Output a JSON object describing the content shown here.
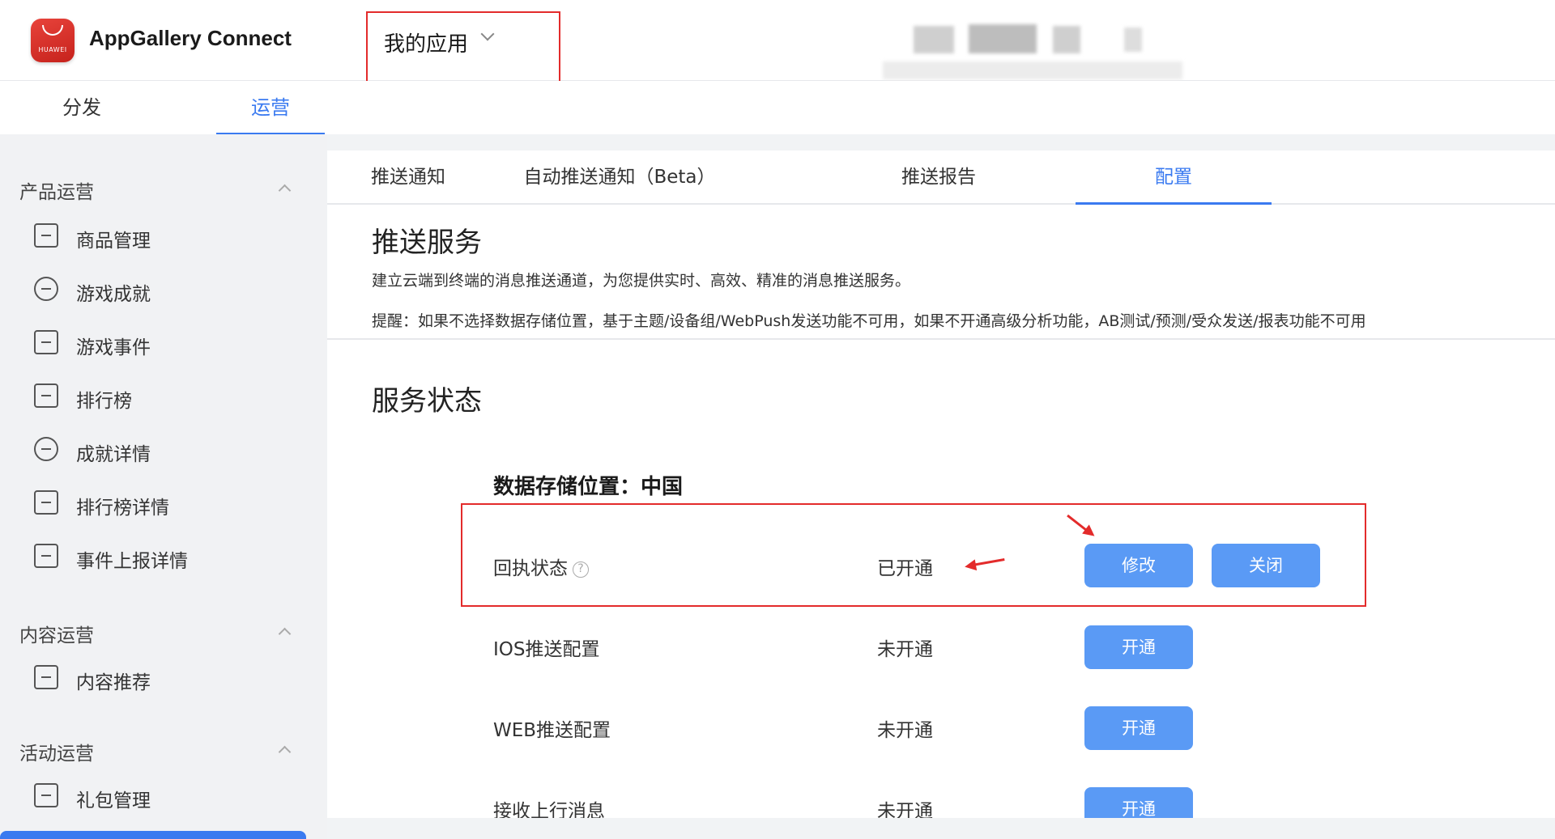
{
  "header": {
    "logo_text": "HUAWEI",
    "brand": "AppGallery Connect",
    "app_selector": "我的应用"
  },
  "topnav": {
    "tabs": [
      {
        "label": "分发",
        "active": false
      },
      {
        "label": "运营",
        "active": true
      }
    ]
  },
  "sidebar": {
    "groups": [
      {
        "title": "产品运营",
        "items": [
          {
            "label": "商品管理",
            "icon": "bag-icon"
          },
          {
            "label": "游戏成就",
            "icon": "achievement-badge-icon"
          },
          {
            "label": "游戏事件",
            "icon": "event-icon"
          },
          {
            "label": "排行榜",
            "icon": "leaderboard-icon"
          },
          {
            "label": "成就详情",
            "icon": "achievement-detail-icon"
          },
          {
            "label": "排行榜详情",
            "icon": "leaderboard-detail-icon"
          },
          {
            "label": "事件上报详情",
            "icon": "event-report-icon"
          }
        ]
      },
      {
        "title": "内容运营",
        "items": [
          {
            "label": "内容推荐",
            "icon": "content-recommend-icon"
          }
        ]
      },
      {
        "title": "活动运营",
        "items": [
          {
            "label": "礼包管理",
            "icon": "gift-icon"
          }
        ]
      }
    ]
  },
  "subtabs": [
    {
      "label": "推送通知",
      "active": false
    },
    {
      "label": "自动推送通知（Beta）",
      "active": false
    },
    {
      "label": "推送报告",
      "active": false
    },
    {
      "label": "配置",
      "active": true
    }
  ],
  "push_service": {
    "title": "推送服务",
    "description": "建立云端到终端的消息推送通道，为您提供实时、高效、精准的消息推送服务。",
    "tip": "提醒：如果不选择数据存储位置，基于主题/设备组/WebPush发送功能不可用，如果不开通高级分析功能，AB测试/预测/受众发送/报表功能不可用"
  },
  "service_status": {
    "title": "服务状态",
    "storage_location": "数据存储位置：中国",
    "rows": [
      {
        "name": "回执状态",
        "help_icon": "?",
        "status": "已开通",
        "buttons": [
          "修改",
          "关闭"
        ]
      },
      {
        "name": "IOS推送配置",
        "status": "未开通",
        "buttons": [
          "开通"
        ]
      },
      {
        "name": "WEB推送配置",
        "status": "未开通",
        "buttons": [
          "开通"
        ]
      },
      {
        "name": "接收上行消息",
        "status": "未开通",
        "buttons": [
          "开通"
        ]
      }
    ]
  },
  "colors": {
    "accent": "#3a7af0",
    "button": "#5a9af5",
    "annotation": "#e32b2b"
  }
}
